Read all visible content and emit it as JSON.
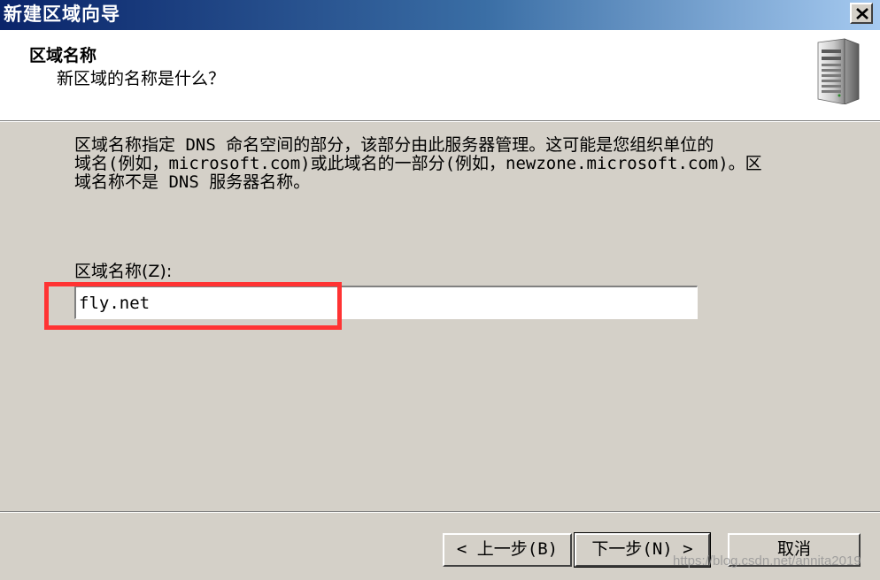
{
  "window": {
    "title": "新建区域向导",
    "close_label": "×"
  },
  "header": {
    "title": "区域名称",
    "subtitle": "新区域的名称是什么？",
    "icon": "server-icon"
  },
  "main": {
    "description_lines": [
      "区域名称指定 DNS 命名空间的部分，该部分由此服务器管理。这可能是您组织单位的",
      "域名(例如，microsoft.com)或此域名的一部分(例如，newzone.microsoft.com)。区",
      "域名称不是 DNS 服务器名称。"
    ],
    "zone_name_label": "区域名称(Z):",
    "zone_name_value": "fly.net"
  },
  "buttons": {
    "back": "< 上一步(B)",
    "next": "下一步(N) >",
    "cancel": "取消"
  },
  "watermark": "https://blog.csdn.net/annita2019",
  "colors": {
    "highlight": "#ff3333",
    "titlebar_start": "#0a246a",
    "titlebar_end": "#a6caf0"
  }
}
